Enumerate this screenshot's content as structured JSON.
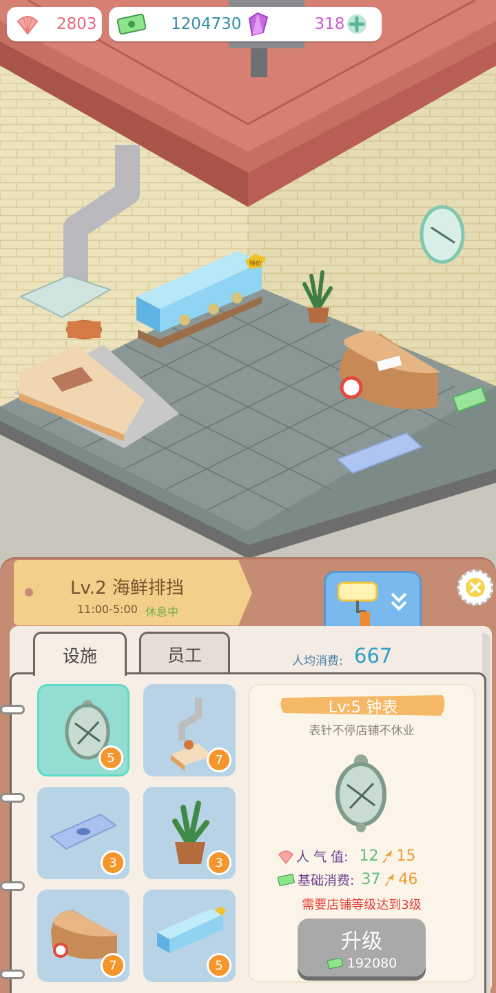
{
  "currency": {
    "shells": "2803",
    "money": "1204730",
    "gems": "318"
  },
  "store": {
    "title": "Lv.2 海鲜排挡",
    "hours": "11:00-5:00",
    "status": "休息中"
  },
  "tabs": [
    {
      "label": "设施"
    },
    {
      "label": "员工"
    }
  ],
  "avg_spend": {
    "label": "人均消费:",
    "value": "667"
  },
  "facilities": [
    {
      "name": "clock",
      "level": "5"
    },
    {
      "name": "kitchen",
      "level": "7"
    },
    {
      "name": "fish-mat",
      "level": "3"
    },
    {
      "name": "plant",
      "level": "3"
    },
    {
      "name": "counter",
      "level": "7"
    },
    {
      "name": "fish-tank",
      "level": "5"
    }
  ],
  "detail": {
    "title": "Lv:5 钟表",
    "description": "表针不停店铺不休业",
    "popularity_label": "人 气 值:",
    "popularity_old": "12",
    "popularity_new": "15",
    "base_label": "基础消费:",
    "base_old": "37",
    "base_new": "46",
    "requirement": "需要店铺等级达到3级",
    "upgrade_label": "升级",
    "upgrade_cost": "192080"
  },
  "scene_labels": {
    "tank_sign": "特价"
  },
  "colors": {
    "brick_roof": "#c97468",
    "wall": "#e9dfb7",
    "floor": "#7c8a87",
    "accent_orange": "#f4962b",
    "teal": "#5fdcc8"
  }
}
